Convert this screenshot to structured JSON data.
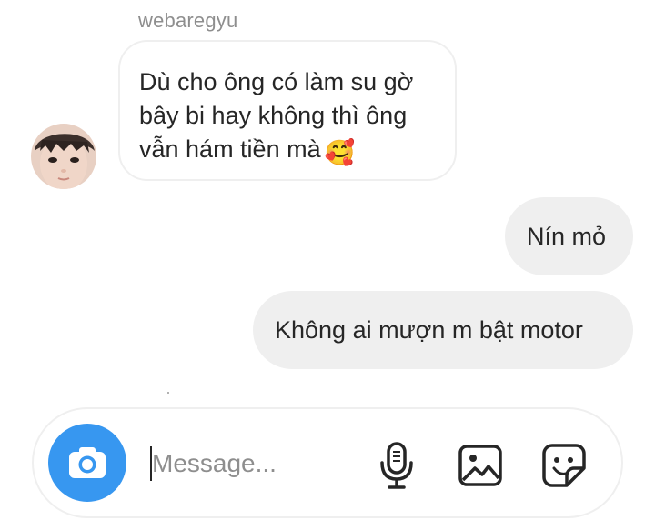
{
  "thread": {
    "sender_username": "webaregyu",
    "incoming": {
      "line1": "Dù cho ông có làm su gờ",
      "line2": "bây bi hay không thì ông",
      "line3": "vẫn hám tiền mà",
      "emoji": "🥰"
    },
    "outgoing": [
      {
        "text": "Nín mỏ"
      },
      {
        "text": "Không ai mượn m bật motor"
      }
    ]
  },
  "composer": {
    "placeholder": "Message...",
    "value": "",
    "camera_icon": "camera-icon",
    "mic_icon": "microphone-icon",
    "gallery_icon": "image-icon",
    "sticker_icon": "sticker-icon"
  },
  "colors": {
    "accent": "#3797f0",
    "outgoing_bubble": "#efefef",
    "incoming_border": "#efefef",
    "text": "#262626",
    "secondary_text": "#8e8e8e"
  }
}
